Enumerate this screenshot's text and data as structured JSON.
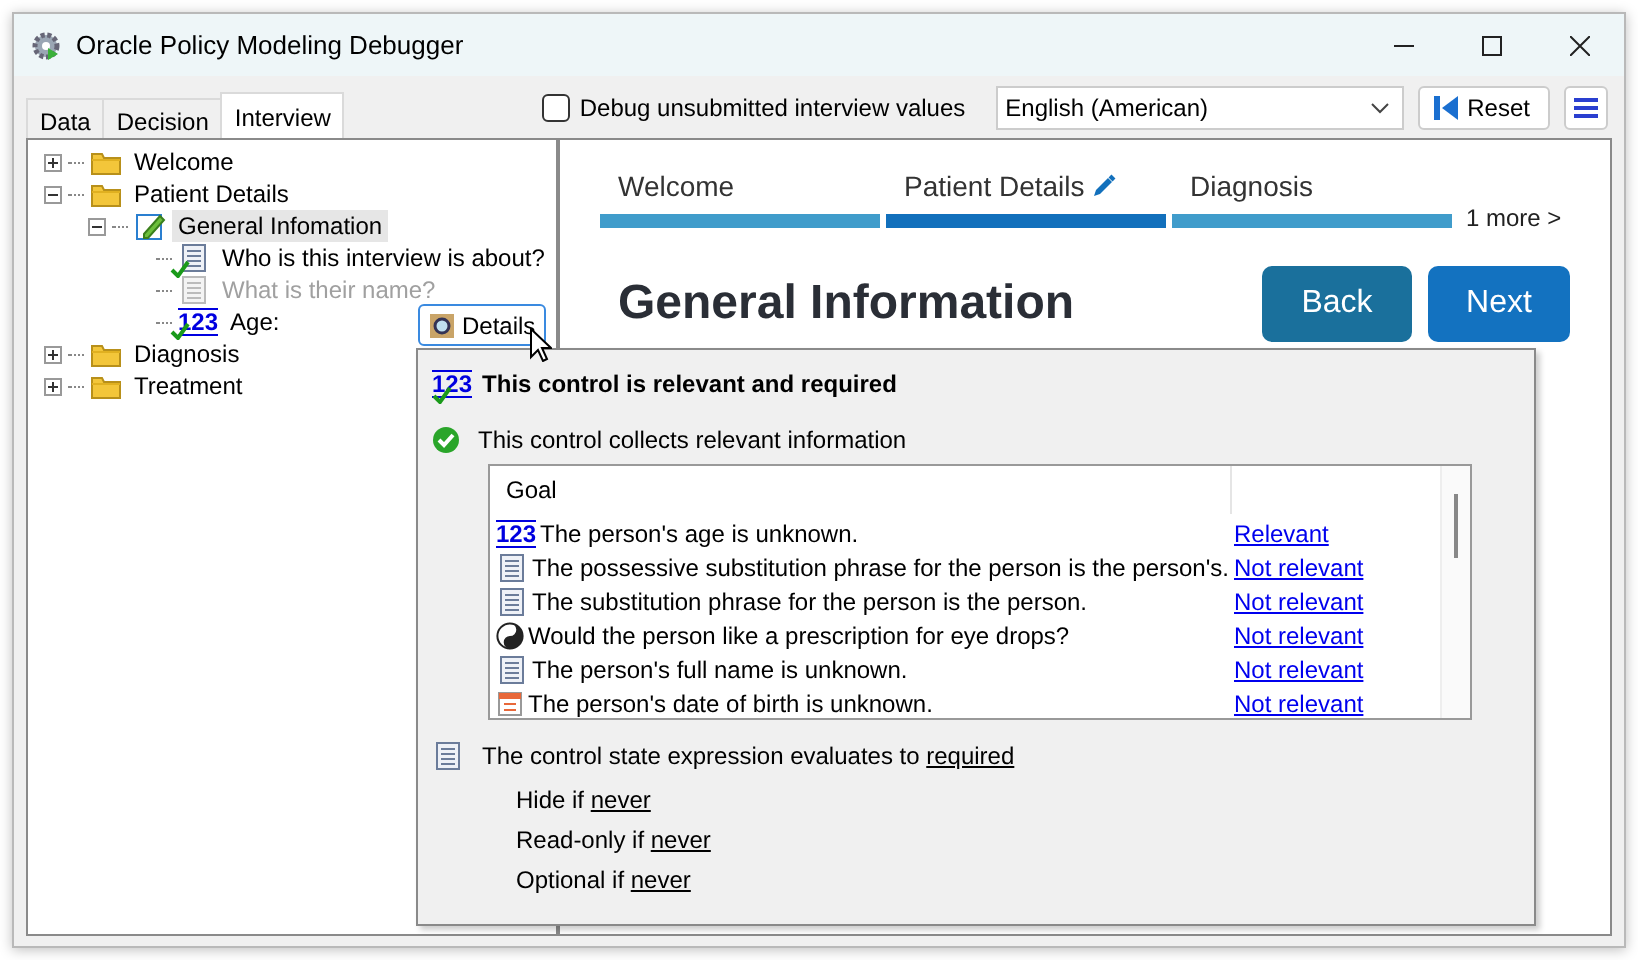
{
  "window": {
    "title": "Oracle Policy Modeling Debugger"
  },
  "tabs": [
    {
      "label": "Data",
      "selected": false
    },
    {
      "label": "Decision",
      "selected": false
    },
    {
      "label": "Interview",
      "selected": true
    }
  ],
  "debug_checkbox": {
    "label": "Debug unsubmitted interview values",
    "checked": false
  },
  "language": {
    "value": "English (American)"
  },
  "reset_button": {
    "label": "Reset"
  },
  "tree": [
    {
      "label": "Welcome",
      "kind": "folder",
      "expanded": false,
      "selected": false
    },
    {
      "label": "Patient Details",
      "kind": "folder",
      "expanded": true,
      "selected": false,
      "children": [
        {
          "label": "General Infomation",
          "kind": "screen",
          "expanded": true,
          "selected": true,
          "children": [
            {
              "label": "Who is this interview is about?",
              "kind": "text",
              "checked": true,
              "disabled": false,
              "selected": false
            },
            {
              "label": "What is their name?",
              "kind": "text",
              "checked": false,
              "disabled": true,
              "selected": false
            },
            {
              "label": "Age:",
              "kind": "number",
              "icon": "123",
              "checked": true,
              "disabled": false,
              "selected": false
            }
          ]
        }
      ]
    },
    {
      "label": "Diagnosis",
      "kind": "folder",
      "expanded": false,
      "selected": false
    },
    {
      "label": "Treatment",
      "kind": "folder",
      "expanded": false,
      "selected": false
    }
  ],
  "details_button": {
    "label": "Details"
  },
  "stages": [
    {
      "label": "Welcome",
      "selected": false
    },
    {
      "label": "Patient Details",
      "selected": true
    },
    {
      "label": "Diagnosis",
      "selected": false
    }
  ],
  "more_link": "1 more >",
  "heading": "General Information",
  "buttons": [
    {
      "label": "Back",
      "kind": "back"
    },
    {
      "label": "Next",
      "kind": "next"
    }
  ],
  "popup": {
    "title_icon": "123",
    "title": "This control is relevant and required",
    "status": "This control collects relevant information",
    "goals": {
      "columns": [
        "Goal"
      ],
      "rows": [
        {
          "kind": "number",
          "icon": "123",
          "text": "The person's age is unknown.",
          "status": "Relevant"
        },
        {
          "kind": "text",
          "text": "The possessive substitution phrase for the person is the person's.",
          "status": "Not relevant"
        },
        {
          "kind": "text",
          "text": "The substitution phrase for the person is the person.",
          "status": "Not relevant"
        },
        {
          "kind": "boolean",
          "text": "Would the person like a prescription for eye drops?",
          "status": "Not relevant"
        },
        {
          "kind": "text",
          "text": "The person's full name is unknown.",
          "status": "Not relevant"
        },
        {
          "kind": "date",
          "text": "The person's date of birth is unknown.",
          "status": "Not relevant"
        }
      ]
    },
    "expression": {
      "text": "The control state expression evaluates to",
      "value": "required"
    },
    "conditions": [
      {
        "label": "Hide if",
        "value": "never"
      },
      {
        "label": "Read-only if",
        "value": "never"
      },
      {
        "label": "Optional if",
        "value": "never"
      }
    ]
  }
}
